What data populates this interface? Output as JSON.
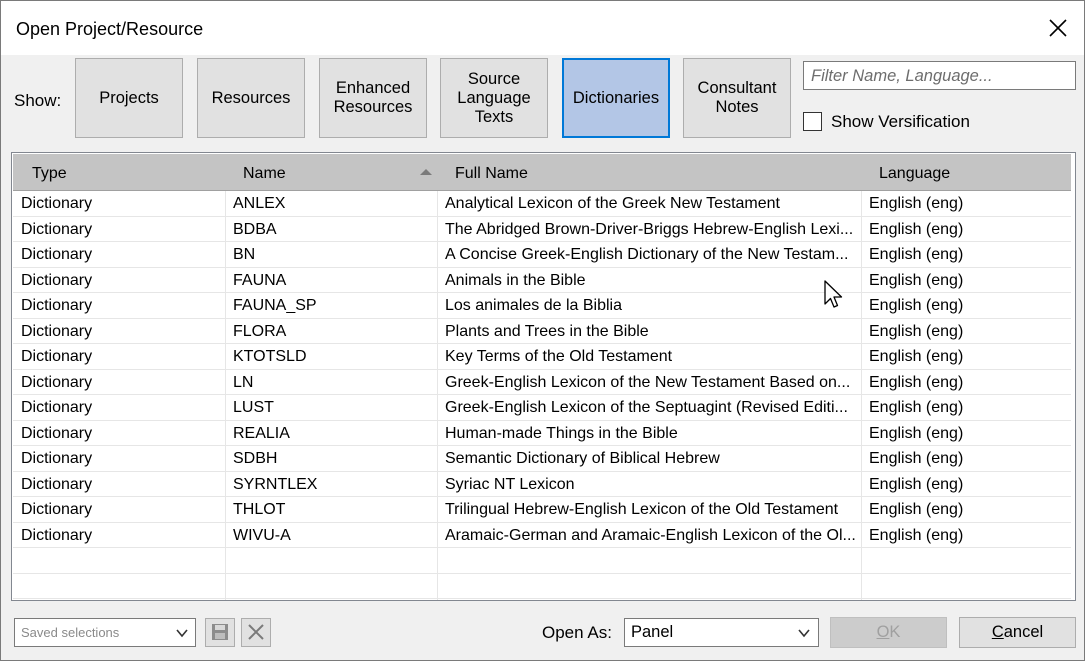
{
  "window": {
    "title": "Open Project/Resource"
  },
  "show": {
    "label": "Show:",
    "filters": [
      {
        "label": "Projects",
        "active": false
      },
      {
        "label": "Resources",
        "active": false
      },
      {
        "label": "Enhanced\nResources",
        "active": false
      },
      {
        "label": "Source\nLanguage\nTexts",
        "active": false
      },
      {
        "label": "Dictionaries",
        "active": true
      },
      {
        "label": "Consultant\nNotes",
        "active": false
      }
    ]
  },
  "filter_input": {
    "placeholder": "Filter Name, Language..."
  },
  "show_verification": {
    "label": "Show Versification",
    "checked": false
  },
  "table": {
    "columns": [
      "Type",
      "Name",
      "Full Name",
      "Language"
    ],
    "rows": [
      [
        "Dictionary",
        "ANLEX",
        "Analytical Lexicon of the Greek New Testament",
        "English (eng)"
      ],
      [
        "Dictionary",
        "BDBA",
        "The Abridged Brown-Driver-Briggs Hebrew-English Lexi...",
        "English (eng)"
      ],
      [
        "Dictionary",
        "BN",
        "A Concise Greek-English Dictionary of the New Testam...",
        "English (eng)"
      ],
      [
        "Dictionary",
        "FAUNA",
        "Animals in the Bible",
        "English (eng)"
      ],
      [
        "Dictionary",
        "FAUNA_SP",
        "Los animales de la Biblia",
        "English (eng)"
      ],
      [
        "Dictionary",
        "FLORA",
        "Plants and Trees in the Bible",
        "English (eng)"
      ],
      [
        "Dictionary",
        "KTOTSLD",
        "Key Terms of the Old Testament",
        "English (eng)"
      ],
      [
        "Dictionary",
        "LN",
        "Greek-English Lexicon of the New Testament Based on...",
        "English (eng)"
      ],
      [
        "Dictionary",
        "LUST",
        "Greek-English Lexicon of the Septuagint (Revised Editi...",
        "English (eng)"
      ],
      [
        "Dictionary",
        "REALIA",
        "Human-made Things in the Bible",
        "English (eng)"
      ],
      [
        "Dictionary",
        "SDBH",
        "Semantic Dictionary of Biblical Hebrew",
        "English (eng)"
      ],
      [
        "Dictionary",
        "SYRNTLEX",
        "Syriac NT Lexicon",
        "English (eng)"
      ],
      [
        "Dictionary",
        "THLOT",
        "Trilingual Hebrew-English Lexicon of the Old Testament",
        "English (eng)"
      ],
      [
        "Dictionary",
        "WIVU-A",
        "Aramaic-German and Aramaic-English Lexicon of the Ol...",
        "English (eng)"
      ]
    ]
  },
  "footer": {
    "saved_selections": "Saved selections",
    "open_as_label": "Open As:",
    "open_as_value": "Panel",
    "ok_label": "OK",
    "cancel_label": "Cancel"
  },
  "icons": {
    "close": "close-icon",
    "save": "save-icon",
    "delete": "delete-x-icon",
    "sort": "sort-ascending-icon",
    "cursor": "mouse-pointer-icon"
  },
  "colors": {
    "active_filter_bg": "#b3c6e6",
    "active_filter_border": "#0078d7",
    "header_bg": "#c4c4c4"
  }
}
